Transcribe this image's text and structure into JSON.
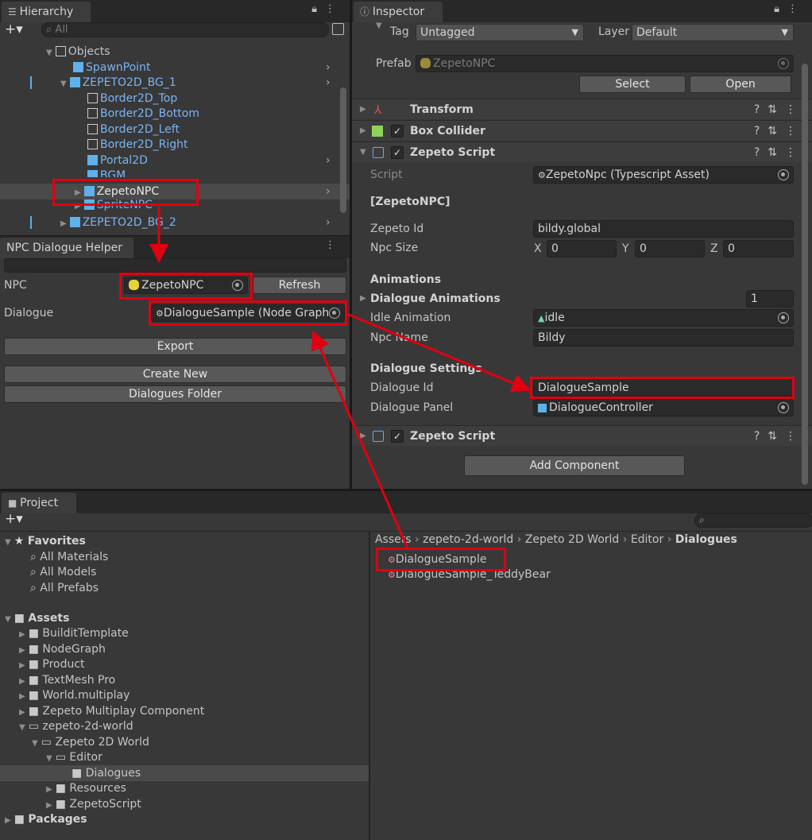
{
  "hierarchy": {
    "tab": "Hierarchy",
    "search_placeholder": "All",
    "items": [
      "Objects",
      "SpawnPoint",
      "ZEPETO2D_BG_1",
      "Border2D_Top",
      "Border2D_Bottom",
      "Border2D_Left",
      "Border2D_Right",
      "Portal2D",
      "BGM",
      "ZepetoNPC",
      "SpriteNPC",
      "ZEPETO2D_BG_2"
    ]
  },
  "helper": {
    "tab": "NPC Dialogue Helper",
    "npc_label": "NPC",
    "npc_value": "ZepetoNPC",
    "refresh": "Refresh",
    "dialogue_label": "Dialogue",
    "dialogue_value": "DialogueSample (Node Graph",
    "export": "Export",
    "create_new": "Create New",
    "dialogues_folder": "Dialogues Folder"
  },
  "inspector": {
    "tab": "Inspector",
    "tag_label": "Tag",
    "tag_value": "Untagged",
    "layer_label": "Layer",
    "layer_value": "Default",
    "prefab_label": "Prefab",
    "prefab_value": "ZepetoNPC",
    "select": "Select",
    "open": "Open",
    "components": [
      "Transform",
      "Box Collider",
      "Zepeto Script",
      "Zepeto Script"
    ],
    "script_label": "Script",
    "script_value": "ZepetoNpc (Typescript Asset)",
    "header": "[ZepetoNPC]",
    "zepeto_id_label": "Zepeto Id",
    "zepeto_id_value": "bildy.global",
    "npc_size_label": "Npc Size",
    "x": "X",
    "x_val": "0",
    "y": "Y",
    "y_val": "0",
    "z": "Z",
    "z_val": "0",
    "animations_header": "Animations",
    "dialogue_animations": "Dialogue Animations",
    "dialogue_animations_count": "1",
    "idle_label": "Idle Animation",
    "idle_value": "idle",
    "npc_name_label": "Npc Name",
    "npc_name_value": "Bildy",
    "dialogue_settings_header": "Dialogue Settings",
    "dialogue_id_label": "Dialogue Id",
    "dialogue_id_value": "DialogueSample",
    "dialogue_panel_label": "Dialogue Panel",
    "dialogue_panel_value": "DialogueController",
    "add_component": "Add Component"
  },
  "project": {
    "tab": "Project",
    "favorites": "Favorites",
    "fav_items": [
      "All Materials",
      "All Models",
      "All Prefabs"
    ],
    "assets": "Assets",
    "folders": [
      "BuilditTemplate",
      "NodeGraph",
      "Product",
      "TextMesh Pro",
      "World.multiplay",
      "Zepeto Multiplay Component",
      "zepeto-2d-world",
      "Zepeto 2D World",
      "Editor",
      "Dialogues",
      "Resources",
      "ZepetoScript"
    ],
    "packages": "Packages",
    "breadcrumb": [
      "Assets",
      "zepeto-2d-world",
      "Zepeto 2D World",
      "Editor",
      "Dialogues"
    ],
    "files": [
      "DialogueSample",
      "DialogueSample_TeddyBear"
    ]
  },
  "colors": {
    "annotation": "#e00010",
    "link_blue": "#7bb4f2"
  }
}
